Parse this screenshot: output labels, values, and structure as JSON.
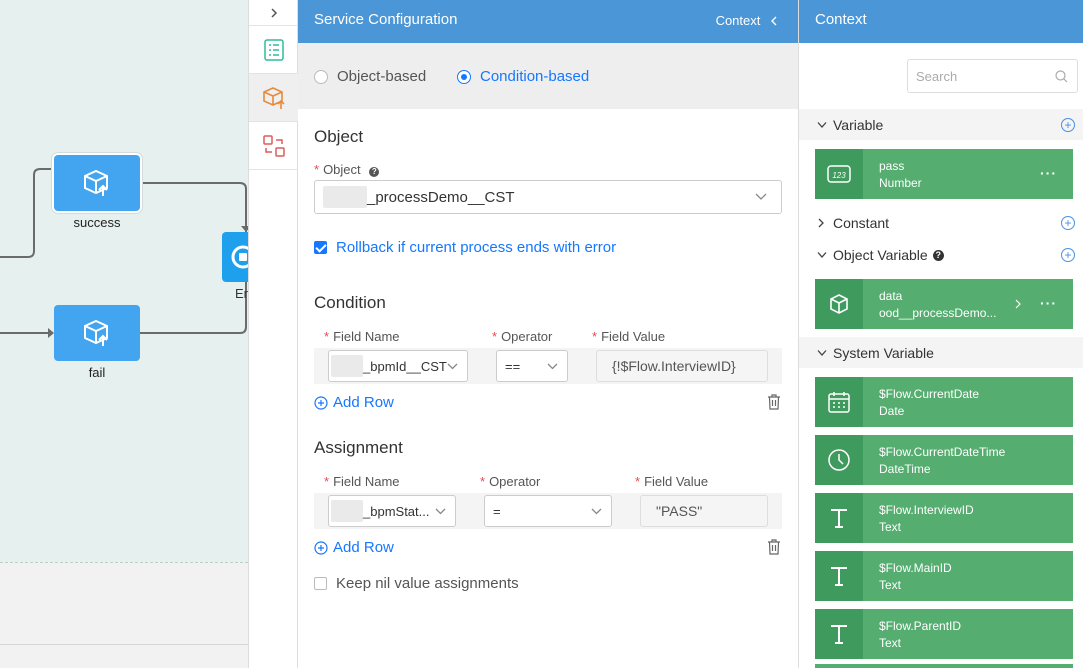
{
  "canvas": {
    "nodes": [
      {
        "label": "success"
      },
      {
        "label": "fail"
      },
      {
        "label": "En"
      }
    ]
  },
  "config": {
    "title": "Service Configuration",
    "context_link": "Context",
    "mode_options": [
      "Object-based",
      "Condition-based"
    ],
    "mode_selected": "Condition-based",
    "object_section": {
      "title": "Object",
      "object_label": "Object",
      "object_value": "_processDemo__CST",
      "rollback_label": "Rollback if current process ends with error",
      "rollback_checked": true
    },
    "condition_section": {
      "title": "Condition",
      "headers": [
        "Field Name",
        "Operator",
        "Field Value"
      ],
      "rows": [
        {
          "field": "_bpmId__CST",
          "operator": "==",
          "value": "{!$Flow.InterviewID}"
        }
      ],
      "add_row": "Add Row"
    },
    "assignment_section": {
      "title": "Assignment",
      "headers": [
        "Field Name",
        "Operator",
        "Field Value"
      ],
      "rows": [
        {
          "field": "_bpmStat...",
          "operator": "=",
          "value": "\"PASS\""
        }
      ],
      "add_row": "Add Row"
    },
    "keep_nil_label": "Keep nil value assignments",
    "keep_nil_checked": false
  },
  "context": {
    "title": "Context",
    "search_placeholder": "Search",
    "groups": {
      "variable": "Variable",
      "constant": "Constant",
      "object_variable": "Object Variable",
      "system_variable": "System Variable"
    },
    "variables": [
      {
        "name": "pass",
        "type": "Number",
        "icon": "number-123-icon"
      }
    ],
    "object_variables": [
      {
        "name": "data",
        "type": "ood__processDemo...",
        "icon": "cube-icon"
      }
    ],
    "system_variables": [
      {
        "name": "$Flow.CurrentDate",
        "type": "Date",
        "icon": "calendar-icon"
      },
      {
        "name": "$Flow.CurrentDateTime",
        "type": "DateTime",
        "icon": "clock-icon"
      },
      {
        "name": "$Flow.InterviewID",
        "type": "Text",
        "icon": "text-t-icon"
      },
      {
        "name": "$Flow.MainID",
        "type": "Text",
        "icon": "text-t-icon"
      },
      {
        "name": "$Flow.ParentID",
        "type": "Text",
        "icon": "text-t-icon"
      }
    ]
  },
  "colors": {
    "header_blue": "#4a96d6",
    "node_blue": "#43a4ef",
    "card_green": "#55ad70",
    "link_blue": "#1677ff",
    "required_red": "#e34d4d"
  }
}
